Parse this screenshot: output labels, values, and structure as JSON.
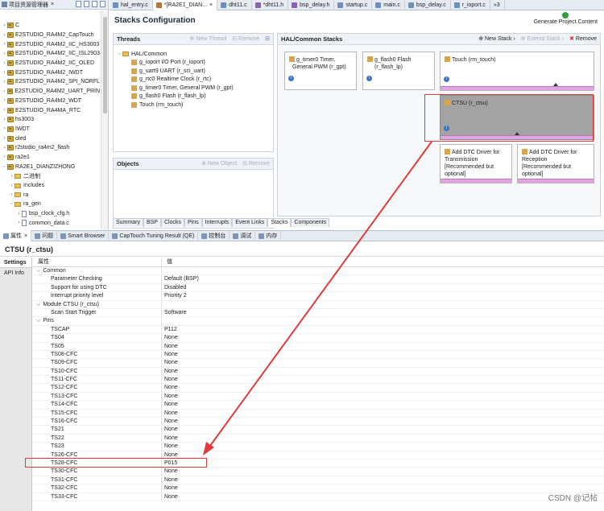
{
  "explorer": {
    "title": "项目资源管理器",
    "items": [
      {
        "label": "C",
        "level": 0,
        "icon": "project"
      },
      {
        "label": "E2STUDIO_RA4M2_CapTouch",
        "level": 0,
        "icon": "project"
      },
      {
        "label": "E2STUDIO_RA4M2_IIC_HS3003",
        "level": 0,
        "icon": "project"
      },
      {
        "label": "E2STUDIO_RA4M2_IIC_ISL2903",
        "level": 0,
        "icon": "project"
      },
      {
        "label": "E2STUDIO_RA4M2_IIC_OLED",
        "level": 0,
        "icon": "project"
      },
      {
        "label": "E2STUDIO_RA4M2_IWDT",
        "level": 0,
        "icon": "project"
      },
      {
        "label": "E2STUDIO_RA4M2_SPI_NORFL",
        "level": 0,
        "icon": "project"
      },
      {
        "label": "E2STUDIO_RA4M2_UART_PRIN",
        "level": 0,
        "icon": "project"
      },
      {
        "label": "E2STUDIO_RA4M2_WDT",
        "level": 0,
        "icon": "project"
      },
      {
        "label": "E2STUDIO_RA4MA_RTC",
        "level": 0,
        "icon": "project"
      },
      {
        "label": "hs3003",
        "level": 0,
        "icon": "project"
      },
      {
        "label": "IWDT",
        "level": 0,
        "icon": "project"
      },
      {
        "label": "oled",
        "level": 0,
        "icon": "project"
      },
      {
        "label": "r2studio_ra4m2_flash",
        "level": 0,
        "icon": "project"
      },
      {
        "label": "ra2e1",
        "level": 0,
        "icon": "project"
      },
      {
        "label": "RA2E1_DIANZIZHONG",
        "level": 0,
        "icon": "project",
        "expanded": true
      },
      {
        "label": "二进制",
        "level": 1,
        "icon": "folder"
      },
      {
        "label": "Includes",
        "level": 1,
        "icon": "folder"
      },
      {
        "label": "ra",
        "level": 1,
        "icon": "folder"
      },
      {
        "label": "ra_gen",
        "level": 1,
        "icon": "folder",
        "expanded": true
      },
      {
        "label": "bsp_clock_cfg.h",
        "level": 2,
        "icon": "file"
      },
      {
        "label": "common_data.c",
        "level": 2,
        "icon": "file"
      }
    ]
  },
  "tabs": [
    {
      "label": "hal_entry.c",
      "type": "c"
    },
    {
      "label": "*[RA2E1_DIAN...",
      "type": "cfg",
      "active": true,
      "close": "×"
    },
    {
      "label": "dht11.c",
      "type": "c"
    },
    {
      "label": "*dht11.h",
      "type": "h"
    },
    {
      "label": "bsp_delay.h",
      "type": "h"
    },
    {
      "label": "startup.c",
      "type": "c"
    },
    {
      "label": "main.c",
      "type": "c"
    },
    {
      "label": "bsp_delay.c",
      "type": "c"
    },
    {
      "label": "r_ioport.c",
      "type": "c"
    },
    {
      "label": "»3",
      "type": "more"
    }
  ],
  "stacks": {
    "title": "Stacks Configuration",
    "generate_label": "Generate Project Content",
    "threads_title": "Threads",
    "new_thread": "New Thread",
    "remove": "Remove",
    "hal_common": "HAL/Common",
    "threads": [
      "g_ioport I/O Port (r_ioport)",
      "g_uart9 UART (r_sci_uart)",
      "g_rtc0 Realtime Clock (r_rtc)",
      "g_timer0 Timer, General PWM (r_gpt)",
      "g_flash0 Flash (r_flash_lp)",
      "Touch (rm_touch)"
    ],
    "objects_title": "Objects",
    "new_object": "New Object",
    "hal_stacks_title": "HAL/Common Stacks",
    "new_stack": "New Stack",
    "extend_stack": "Extend Stack",
    "card_timer_l1": "g_timer0 Timer,",
    "card_timer_l2": "General PWM (r_gpt)",
    "card_flash_l1": "g_flash0 Flash",
    "card_flash_l2": "(r_flash_lp)",
    "card_touch": "Touch (rm_touch)",
    "card_ctsu": "CTSU (r_ctsu)",
    "card_dtc_tx": [
      "Add DTC Driver for",
      "Transmission",
      "[Recommended but",
      "optional]"
    ],
    "card_dtc_rx": [
      "Add DTC Driver for",
      "Reception",
      "[Recommended but",
      "optional]"
    ],
    "subtabs": [
      "Summary",
      "BSP",
      "Clocks",
      "Pins",
      "Interrupts",
      "Event Links",
      "Stacks",
      "Components"
    ]
  },
  "viewtabs": [
    {
      "label": "属性",
      "active": true,
      "close": "×"
    },
    {
      "label": "问题"
    },
    {
      "label": "Smart Browser"
    },
    {
      "label": "CapTouch Tuning Result (QE)"
    },
    {
      "label": "控制台"
    },
    {
      "label": "调试"
    },
    {
      "label": "内存"
    }
  ],
  "props": {
    "title": "CTSU (r_ctsu)",
    "side_tabs": [
      "Settings",
      "API Info"
    ],
    "col_property": "属性",
    "col_value": "值",
    "rows": [
      {
        "name": "Common",
        "value": "",
        "level": 0,
        "group": true
      },
      {
        "name": "Parameter Checking",
        "value": "Default (BSP)",
        "level": 1
      },
      {
        "name": "Support for using DTC",
        "value": "Disabled",
        "level": 1
      },
      {
        "name": "Interrupt priority level",
        "value": "Priority 2",
        "level": 1
      },
      {
        "name": "Module  CTSU (r_ctsu)",
        "value": "",
        "level": 0,
        "group": true
      },
      {
        "name": "Scan Start Trigger",
        "value": "Software",
        "level": 1
      },
      {
        "name": "Pins",
        "value": "",
        "level": 0,
        "group": true
      },
      {
        "name": "TSCAP",
        "value": "P112",
        "level": 1
      },
      {
        "name": "TS04",
        "value": "None",
        "level": 1
      },
      {
        "name": "TS05",
        "value": "None",
        "level": 1
      },
      {
        "name": "TS08-CFC",
        "value": "None",
        "level": 1
      },
      {
        "name": "TS09-CFC",
        "value": "None",
        "level": 1
      },
      {
        "name": "TS10-CFC",
        "value": "None",
        "level": 1
      },
      {
        "name": "TS11-CFC",
        "value": "None",
        "level": 1
      },
      {
        "name": "TS12-CFC",
        "value": "None",
        "level": 1
      },
      {
        "name": "TS13-CFC",
        "value": "None",
        "level": 1
      },
      {
        "name": "TS14-CFC",
        "value": "None",
        "level": 1
      },
      {
        "name": "TS15-CFC",
        "value": "None",
        "level": 1
      },
      {
        "name": "TS16-CFC",
        "value": "None",
        "level": 1
      },
      {
        "name": "TS21",
        "value": "None",
        "level": 1
      },
      {
        "name": "TS22",
        "value": "None",
        "level": 1
      },
      {
        "name": "TS23",
        "value": "None",
        "level": 1
      },
      {
        "name": "TS26-CFC",
        "value": "None",
        "level": 1
      },
      {
        "name": "TS28-CFC",
        "value": "P015",
        "level": 1,
        "highlight": true
      },
      {
        "name": "TS30-CFC",
        "value": "None",
        "level": 1
      },
      {
        "name": "TS31-CFC",
        "value": "None",
        "level": 1
      },
      {
        "name": "TS32-CFC",
        "value": "None",
        "level": 1
      },
      {
        "name": "TS33-CFC",
        "value": "None",
        "level": 1
      }
    ]
  },
  "watermark": "CSDN @记帖",
  "colors": {
    "annotation": "#e03a3a",
    "selected_card": "#a3a3a3",
    "card_bar": "#e3a2e3"
  }
}
